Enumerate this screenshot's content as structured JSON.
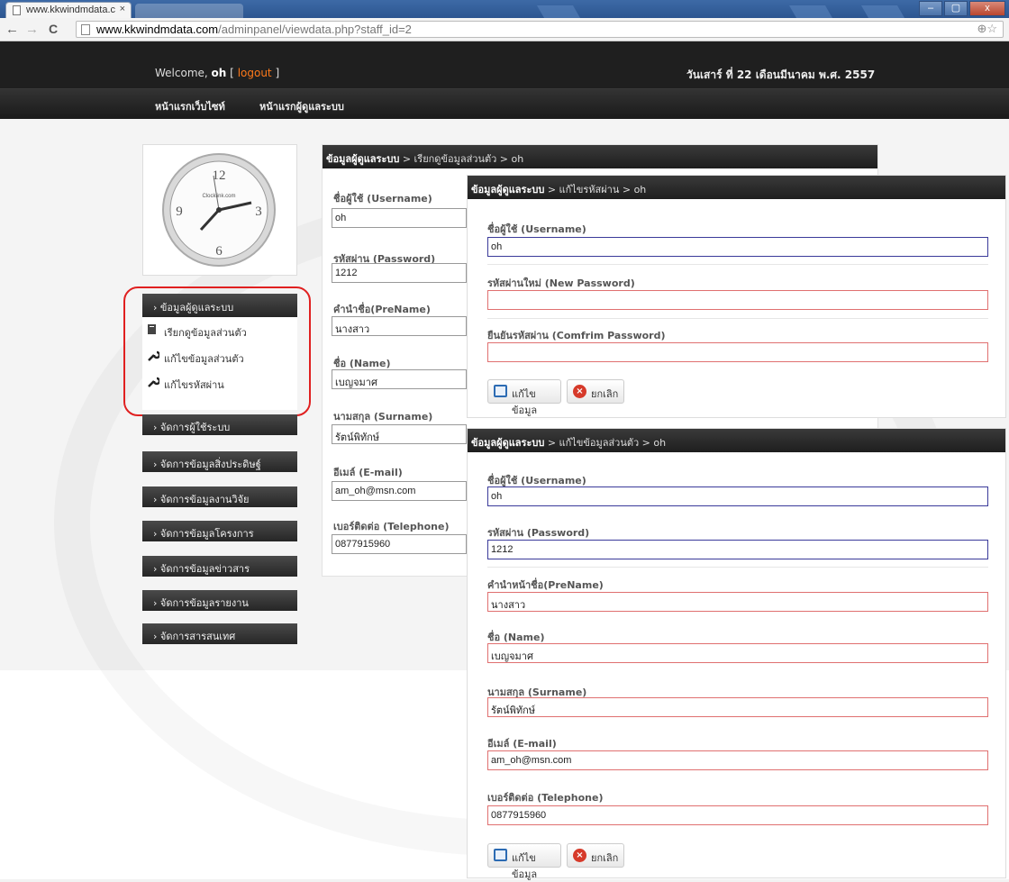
{
  "browser": {
    "tab_title": "www.kkwindmdata.c",
    "tab_close": "×",
    "url_host": "www.kkwindmdata.com",
    "url_path": "/adminpanel/viewdata.php?staff_id=2",
    "back": "←",
    "forward": "→",
    "reload": "C",
    "zoom_star": "⊕☆",
    "win_min": "–",
    "win_max": "▢",
    "win_close": "x"
  },
  "header": {
    "welcome_prefix": "Welcome,",
    "user": "oh",
    "logout_open": "[",
    "logout": "logout",
    "logout_close": "]",
    "date": "วันเสาร์ ที่ 22 เดือนมีนาคม พ.ศ. 2557",
    "menu": [
      "หน้าแรกเว็บไซท์",
      "หน้าแรกผู้ดูแลระบบ"
    ]
  },
  "clock": {
    "brand": "Clocklink.com",
    "n12": "12",
    "n3": "3",
    "n6": "6",
    "n9": "9"
  },
  "sidebar": {
    "header": "› ข้อมูลผู้ดูแลระบบ",
    "items": [
      {
        "label": "เรียกดูข้อมูลส่วนตัว",
        "icon": "document-icon"
      },
      {
        "label": "แก้ไขข้อมูลส่วนตัว",
        "icon": "wrench-icon"
      },
      {
        "label": "แก้ไขรหัสผ่าน",
        "icon": "wrench-icon"
      }
    ],
    "menus": [
      "› จัดการผู้ใช้ระบบ",
      "› จัดการข้อมูลสิ่งประดิษฐ์",
      "› จัดการข้อมูลงานวิจัย",
      "› จัดการข้อมูลโครงการ",
      "› จัดการข้อมูลข่าวสาร",
      "› จัดการข้อมูลรายงาน",
      "› จัดการสารสนเทศ"
    ]
  },
  "view_panel": {
    "crumb_bold": "ข้อมูลผู้ดูแลระบบ",
    "crumb_rest": " > เรียกดูข้อมูลส่วนตัว > oh",
    "fields": [
      {
        "label": "ชื่อผู้ใช้ (Username)",
        "value": "oh"
      },
      {
        "label": "รหัสผ่าน (Password)",
        "value": "1212"
      },
      {
        "label": "คำนำชื่อ(PreName)",
        "value": "นางสาว"
      },
      {
        "label": "ชื่อ (Name)",
        "value": "เบญจมาศ"
      },
      {
        "label": "นามสกุล (Surname)",
        "value": "รัตน์พิทักษ์"
      },
      {
        "label": "อีเมล์ (E-mail)",
        "value": "am_oh@msn.com"
      },
      {
        "label": "เบอร์ติดต่อ (Telephone)",
        "value": "0877915960"
      }
    ]
  },
  "password_panel": {
    "crumb_bold": "ข้อมูลผู้ดูแลระบบ",
    "crumb_rest": " > แก้ไขรหัสผ่าน > oh",
    "fields": [
      {
        "label": "ชื่อผู้ใช้ (Username)",
        "value": "oh"
      },
      {
        "label": "รหัสผ่านใหม่ (New Password)",
        "value": ""
      },
      {
        "label": "ยืนยันรหัสผ่าน (Comfrim Password)",
        "value": ""
      }
    ],
    "save": "แก้ไขข้อมูล",
    "cancel": "ยกเลิก"
  },
  "profile_panel": {
    "crumb_bold": "ข้อมูลผู้ดูแลระบบ",
    "crumb_rest": " > แก้ไขข้อมูลส่วนตัว > oh",
    "fields": [
      {
        "label": "ชื่อผู้ใช้ (Username)",
        "value": "oh"
      },
      {
        "label": "รหัสผ่าน (Password)",
        "value": "1212"
      },
      {
        "label": "คำนำหน้าชื่อ(PreName)",
        "value": "นางสาว"
      },
      {
        "label": "ชื่อ (Name)",
        "value": "เบญจมาศ"
      },
      {
        "label": "นามสกุล (Surname)",
        "value": "รัตน์พิทักษ์"
      },
      {
        "label": "อีเมล์ (E-mail)",
        "value": "am_oh@msn.com"
      },
      {
        "label": "เบอร์ติดต่อ (Telephone)",
        "value": "0877915960"
      }
    ],
    "save": "แก้ไขข้อมูล",
    "cancel": "ยกเลิก"
  },
  "colors": {
    "accent_logout": "#ff7a1a",
    "highlight_ring": "#e02020",
    "invalid_border": "#e07070"
  }
}
